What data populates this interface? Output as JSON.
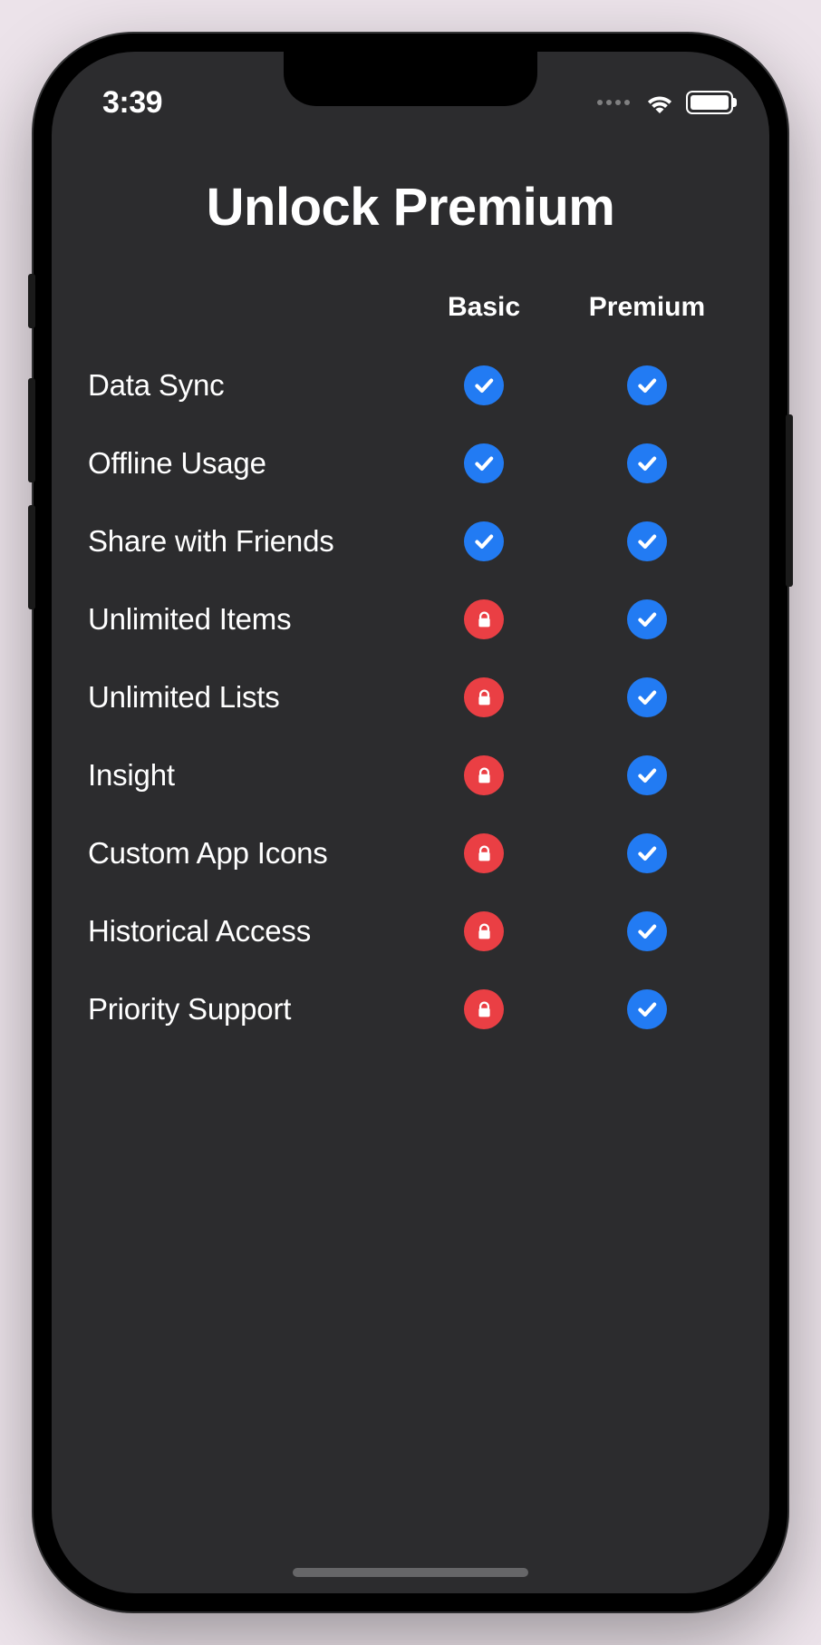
{
  "status": {
    "time": "3:39"
  },
  "page": {
    "title": "Unlock Premium"
  },
  "columns": {
    "basic": "Basic",
    "premium": "Premium"
  },
  "features": [
    {
      "label": "Data Sync",
      "basic": "check",
      "premium": "check"
    },
    {
      "label": "Offline Usage",
      "basic": "check",
      "premium": "check"
    },
    {
      "label": "Share with Friends",
      "basic": "check",
      "premium": "check"
    },
    {
      "label": "Unlimited Items",
      "basic": "lock",
      "premium": "check"
    },
    {
      "label": "Unlimited Lists",
      "basic": "lock",
      "premium": "check"
    },
    {
      "label": "Insight",
      "basic": "lock",
      "premium": "check"
    },
    {
      "label": "Custom App Icons",
      "basic": "lock",
      "premium": "check"
    },
    {
      "label": "Historical Access",
      "basic": "lock",
      "premium": "check"
    },
    {
      "label": "Priority Support",
      "basic": "lock",
      "premium": "check"
    }
  ],
  "icons": {
    "check": "check-icon",
    "lock": "lock-icon"
  },
  "colors": {
    "background": "#2c2c2e",
    "check_badge": "#227bf3",
    "lock_badge": "#ea3f44",
    "text": "#ffffff"
  }
}
